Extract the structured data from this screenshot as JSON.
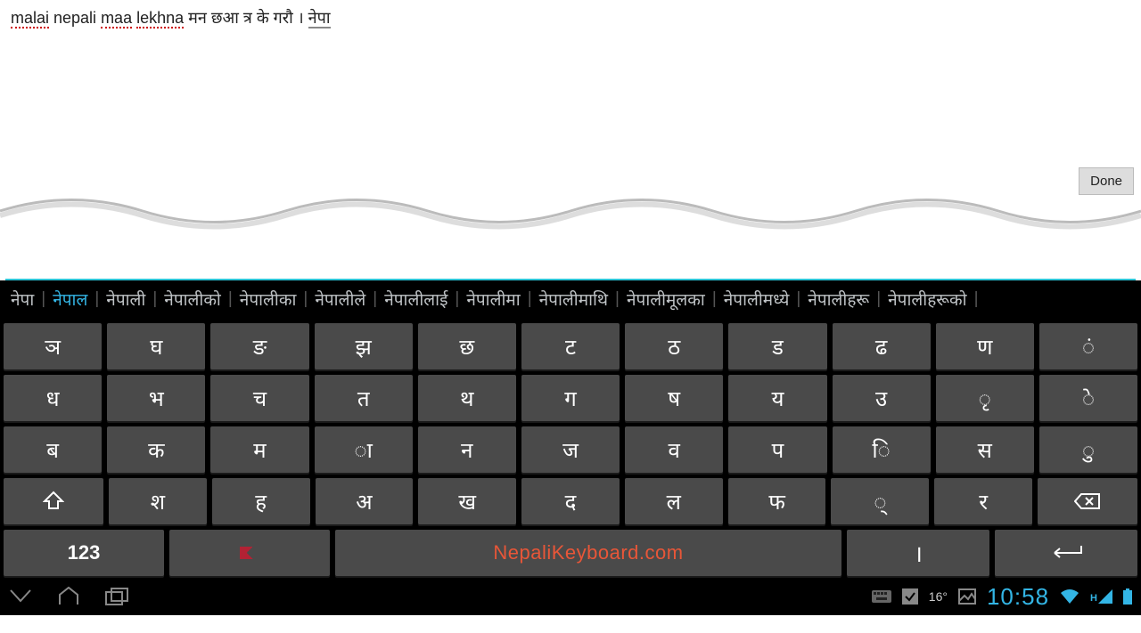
{
  "text_input": {
    "segments": [
      {
        "text": "malai",
        "class": "underlined"
      },
      {
        "text": " nepali ",
        "class": ""
      },
      {
        "text": "maa",
        "class": "underlined"
      },
      {
        "text": " ",
        "class": ""
      },
      {
        "text": "lekhna",
        "class": "underlined"
      },
      {
        "text": " मन छआ त्र के गरौ । ",
        "class": ""
      },
      {
        "text": "नेपा",
        "class": "underlined-gray"
      }
    ]
  },
  "done_button": {
    "label": "Done"
  },
  "suggestions": [
    {
      "text": "नेपा",
      "active": false
    },
    {
      "text": "नेपाल",
      "active": true
    },
    {
      "text": "नेपाली",
      "active": false
    },
    {
      "text": "नेपालीको",
      "active": false
    },
    {
      "text": "नेपालीका",
      "active": false
    },
    {
      "text": "नेपालीले",
      "active": false
    },
    {
      "text": "नेपालीलाई",
      "active": false
    },
    {
      "text": "नेपालीमा",
      "active": false
    },
    {
      "text": "नेपालीमाथि",
      "active": false
    },
    {
      "text": "नेपालीमूलका",
      "active": false
    },
    {
      "text": "नेपालीमध्ये",
      "active": false
    },
    {
      "text": "नेपालीहरू",
      "active": false
    },
    {
      "text": "नेपालीहरूको",
      "active": false
    }
  ],
  "keyboard": {
    "row1": [
      "ञ",
      "घ",
      "ङ",
      "झ",
      "छ",
      "ट",
      "ठ",
      "ड",
      "ढ",
      "ण",
      "ं"
    ],
    "row2": [
      "ध",
      "भ",
      "च",
      "त",
      "थ",
      "ग",
      "ष",
      "य",
      "उ",
      "ृ",
      "े"
    ],
    "row3": [
      "ब",
      "क",
      "म",
      "ा",
      "न",
      "ज",
      "व",
      "प",
      "ि",
      "स",
      "ु"
    ],
    "row4_after_shift": [
      "श",
      "ह",
      "अ",
      "ख",
      "द",
      "ल",
      "फ",
      "्",
      "र"
    ],
    "num_label": "123",
    "space_label": "NepaliKeyboard.com",
    "danda_label": "।"
  },
  "navbar": {
    "weather": "16°",
    "time": "10:58",
    "signal_prefix": "H"
  }
}
